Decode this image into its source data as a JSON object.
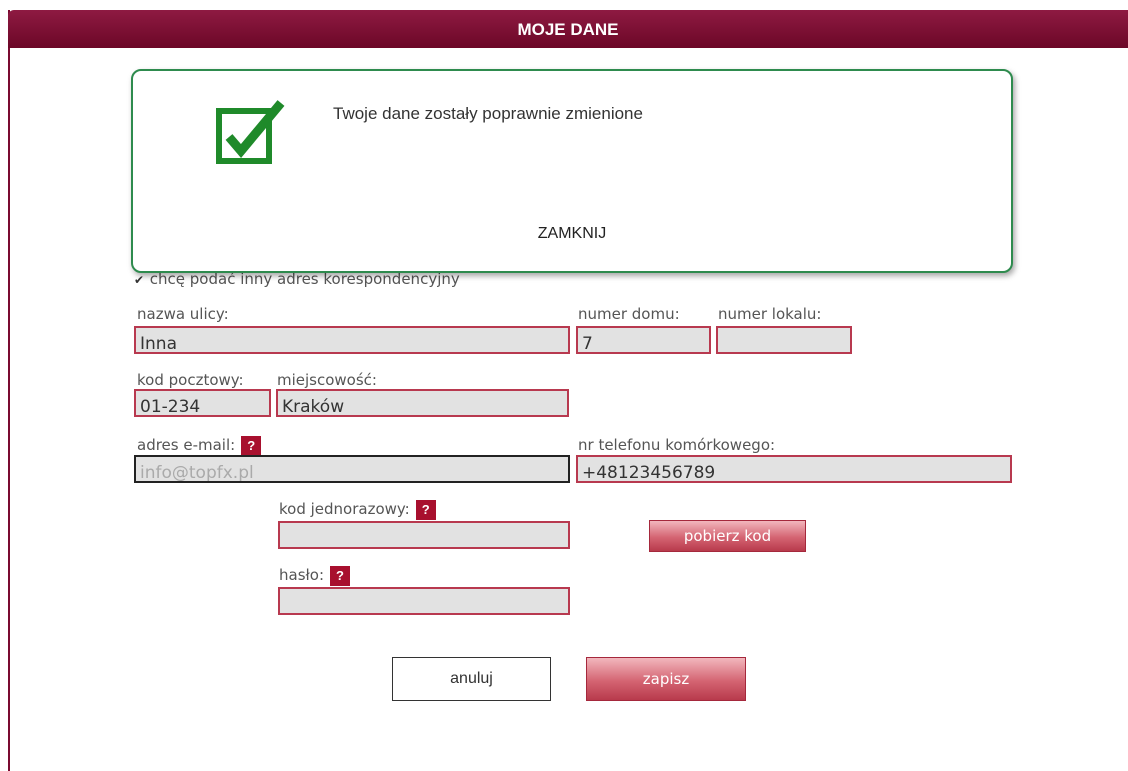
{
  "header": {
    "title": "MOJE DANE"
  },
  "modal": {
    "message": "Twoje dane zostały poprawnie zmienione",
    "close_label": "ZAMKNIJ",
    "icon": "checkmark-icon"
  },
  "form": {
    "alt_address_checkbox": {
      "label": "chcę podać inny adres korespondencyjny",
      "checked": true
    },
    "street": {
      "label": "nazwa ulicy:",
      "value": "Inna"
    },
    "house_number": {
      "label": "numer domu:",
      "value": "7"
    },
    "apartment_number": {
      "label": "numer lokalu:",
      "value": ""
    },
    "postal_code": {
      "label": "kod pocztowy:",
      "value": "01-234"
    },
    "city": {
      "label": "miejscowość:",
      "value": "Kraków"
    },
    "email": {
      "label": "adres e-mail:",
      "value": "info@topfx.pl",
      "help": "?"
    },
    "phone": {
      "label": "nr telefonu komórkowego:",
      "value": "+48123456789"
    },
    "one_time_code": {
      "label": "kod jednorazowy:",
      "value": "",
      "help": "?"
    },
    "get_code_button": "pobierz kod",
    "password": {
      "label": "hasło:",
      "value": "",
      "help": "?"
    },
    "cancel_button": "anuluj",
    "save_button": "zapisz"
  },
  "colors": {
    "header_bg": "#7a0a30",
    "field_border": "#b8394f",
    "modal_border": "#2e8b4e",
    "accent_red": "#a8102e"
  }
}
